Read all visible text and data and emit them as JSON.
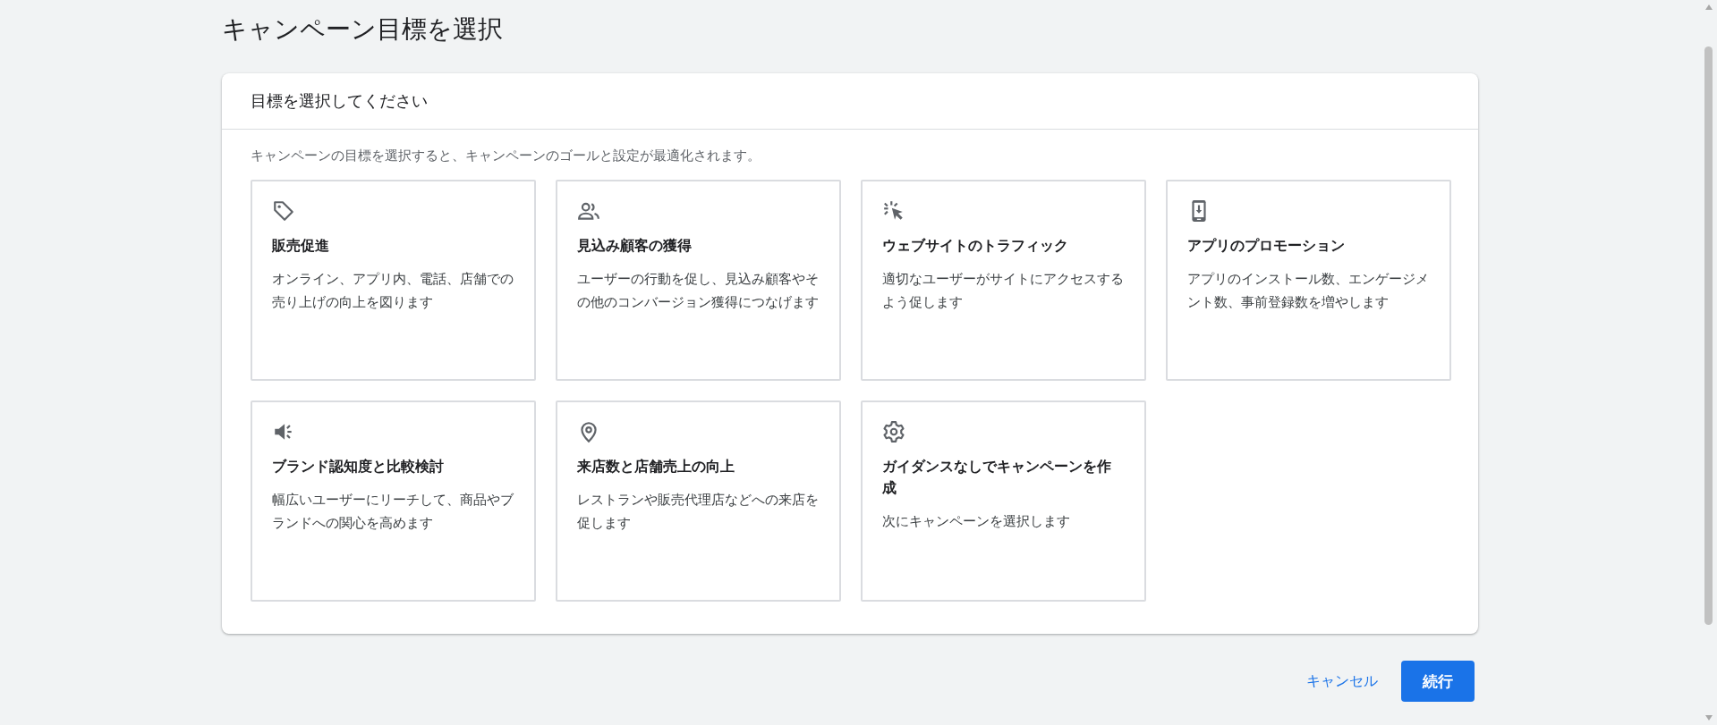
{
  "page_title": "キャンペーン目標を選択",
  "panel": {
    "heading": "目標を選択してください",
    "description": "キャンペーンの目標を選択すると、キャンペーンのゴールと設定が最適化されます。",
    "goals": [
      {
        "title": "販売促進",
        "description": "オンライン、アプリ内、電話、店舗での売り上げの向上を図ります"
      },
      {
        "title": "見込み顧客の獲得",
        "description": "ユーザーの行動を促し、見込み顧客やその他のコンバージョン獲得につなげます"
      },
      {
        "title": "ウェブサイトのトラフィック",
        "description": "適切なユーザーがサイトにアクセスするよう促します"
      },
      {
        "title": "アプリのプロモーション",
        "description": "アプリのインストール数、エンゲージメント数、事前登録数を増やします"
      },
      {
        "title": "ブランド認知度と比較検討",
        "description": "幅広いユーザーにリーチして、商品やブランドへの関心を高めます"
      },
      {
        "title": "来店数と店舗売上の向上",
        "description": "レストランや販売代理店などへの来店を促します"
      },
      {
        "title": "ガイダンスなしでキャンペーンを作成",
        "description": "次にキャンペーンを選択します"
      }
    ]
  },
  "actions": {
    "cancel": "キャンセル",
    "continue": "続行"
  }
}
